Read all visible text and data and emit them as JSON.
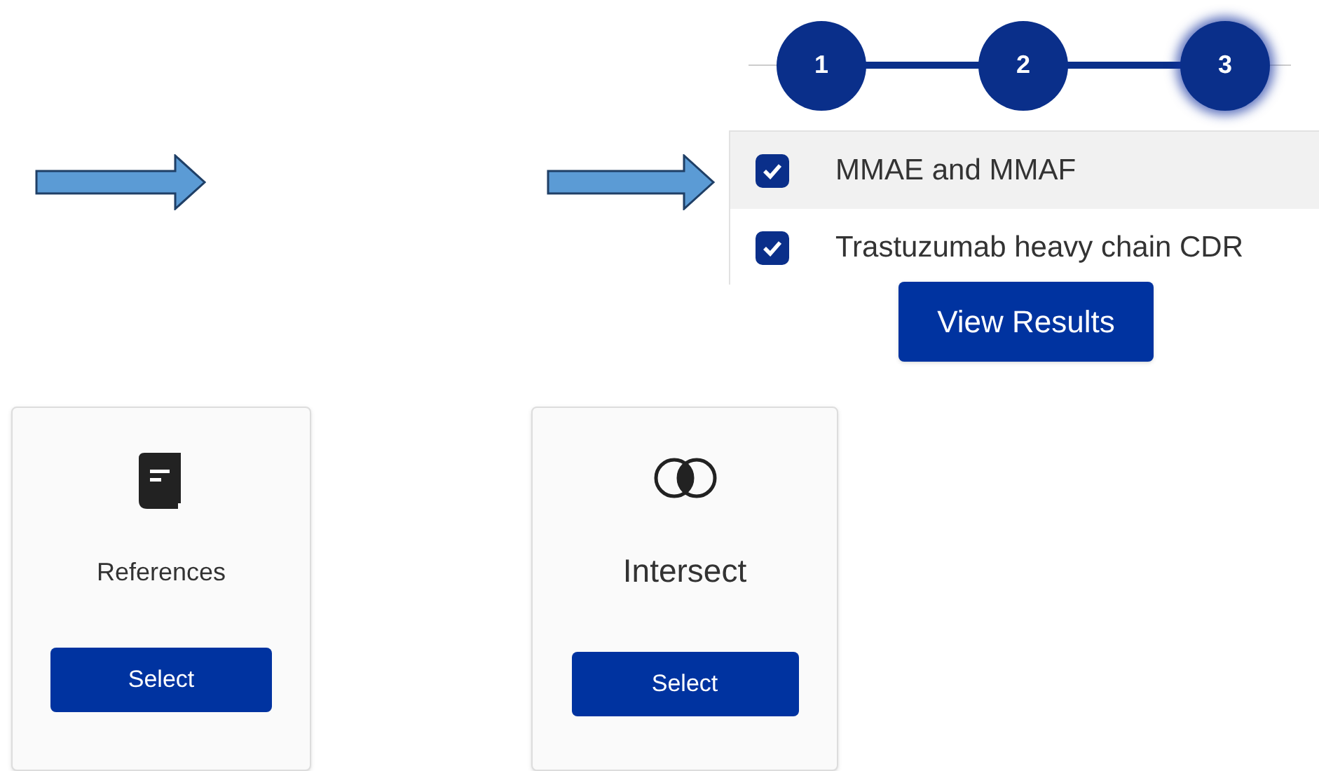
{
  "steps": [
    {
      "label": "1",
      "selected": false
    },
    {
      "label": "2",
      "selected": false
    },
    {
      "label": "3",
      "selected": true
    }
  ],
  "options": [
    {
      "label": "MMAE and MMAF",
      "checked": true,
      "selected": true
    },
    {
      "label": "Trastuzumab heavy chain CDR",
      "checked": true,
      "selected": false
    }
  ],
  "view_button": "View Results",
  "cards": [
    {
      "kind": "book",
      "title": "References",
      "button": "Select"
    },
    {
      "kind": "intersect",
      "title": "Intersect",
      "button": "Select"
    }
  ]
}
